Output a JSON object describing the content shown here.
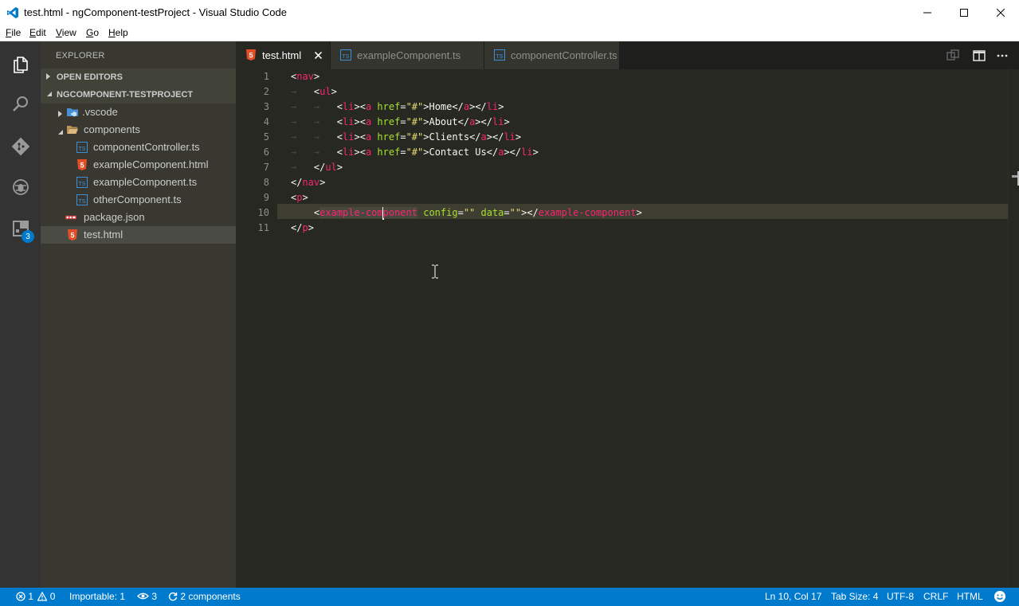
{
  "window": {
    "title": "test.html - ngComponent-testProject - Visual Studio Code",
    "minimize_glyph": "—",
    "maximize_glyph": "☐",
    "close_glyph": "✕"
  },
  "menu": {
    "file": {
      "first": "F",
      "rest": "ile"
    },
    "edit": {
      "first": "E",
      "rest": "dit"
    },
    "view": {
      "first": "V",
      "rest": "iew"
    },
    "go": {
      "first": "G",
      "rest": "o"
    },
    "help": {
      "first": "H",
      "rest": "elp"
    }
  },
  "activity_bar": {
    "icons": [
      "explorer-icon",
      "search-icon",
      "git-icon",
      "debug-icon",
      "extensions-icon"
    ],
    "extensions_badge": "3"
  },
  "sidebar": {
    "title": "EXPLORER",
    "open_editors": {
      "label": "OPEN EDITORS",
      "expanded": false
    },
    "project": {
      "label": "NGCOMPONENT-TESTPROJECT",
      "expanded": true
    },
    "tree": [
      {
        "label": ".vscode",
        "kind": "folder",
        "expanded": false,
        "depth": 1
      },
      {
        "label": "components",
        "kind": "folder",
        "expanded": true,
        "depth": 1
      },
      {
        "label": "componentController.ts",
        "kind": "ts",
        "depth": 2
      },
      {
        "label": "exampleComponent.html",
        "kind": "html",
        "depth": 2
      },
      {
        "label": "exampleComponent.ts",
        "kind": "ts",
        "depth": 2
      },
      {
        "label": "otherComponent.ts",
        "kind": "ts",
        "depth": 2
      },
      {
        "label": "package.json",
        "kind": "json",
        "depth": 1
      },
      {
        "label": "test.html",
        "kind": "html",
        "depth": 1,
        "selected": true
      }
    ],
    "close_glyph": "×"
  },
  "tabs": [
    {
      "label": "test.html",
      "kind": "html",
      "active": true,
      "close": "✕"
    },
    {
      "label": "exampleComponent.ts",
      "kind": "ts",
      "active": false
    },
    {
      "label": "componentController.ts",
      "kind": "ts",
      "active": false
    }
  ],
  "icon_glyphs": {
    "html": "5",
    "ts": "TS",
    "json": "{}",
    "chev_right": "▶",
    "chev_down": "◢"
  },
  "editor": {
    "line_numbers": [
      "1",
      "2",
      "3",
      "4",
      "5",
      "6",
      "7",
      "8",
      "9",
      "10",
      "11"
    ],
    "current_line": 10,
    "code": {
      "l1": {
        "open": "<",
        "tag": "nav",
        "close": ">"
      },
      "l2": {
        "ws": "→   ",
        "open": "<",
        "tag": "ul",
        "close": ">"
      },
      "l3": {
        "ws": "→   →   ",
        "text": "Home"
      },
      "l4": {
        "ws": "→   →   ",
        "text": "About"
      },
      "l5": {
        "ws": "→   →   ",
        "text": "Clients"
      },
      "l6": {
        "ws": "→   →   ",
        "text": "Contact Us"
      },
      "l7": {
        "ws": "→   ",
        "open": "</",
        "tag": "ul",
        "close": ">"
      },
      "l8": {
        "open": "</",
        "tag": "nav",
        "close": ">"
      },
      "l9": {
        "open": "<",
        "tag": "p",
        "close": ">"
      },
      "l10": {
        "ws": "    ",
        "open": "<",
        "tag_a": "example-com",
        "tag_b": "ponent",
        "attr1": "config",
        "eq": "=",
        "val1": "\"\"",
        "attr2": "data",
        "val2": "\"\"",
        "mid": "></",
        "end_tag": "example-component",
        "close": ">"
      },
      "l11": {
        "open": "</",
        "tag": "p",
        "close": ">"
      },
      "li_parts": {
        "lt": "<",
        "li": "li",
        "gt": ">",
        "a": "a",
        "href": "href",
        "eq": "=",
        "val": "\"#\"",
        "lts": "</",
        "sp": " "
      }
    }
  },
  "status_bar": {
    "errors": "1",
    "warnings": "0",
    "importable": "Importable: 1",
    "references": "3",
    "components": "2 components",
    "position": "Ln 10, Col 17",
    "tab_size": "Tab Size: 4",
    "encoding": "UTF-8",
    "eol": "CRLF",
    "language": "HTML",
    "error_glyph": "⊗",
    "warning_glyph": "⚠",
    "eye_glyph": "👁",
    "sync_glyph": "⟳",
    "smiley_glyph": "☺"
  }
}
